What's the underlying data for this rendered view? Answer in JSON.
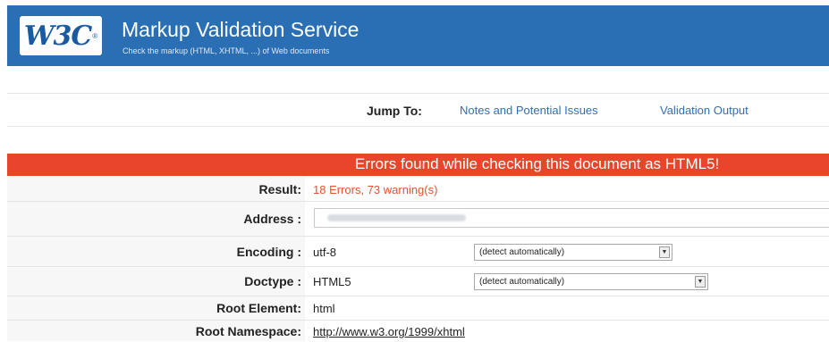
{
  "header": {
    "logo_text": "W3C",
    "logo_reg": "®",
    "title": "Markup Validation Service",
    "subtitle": "Check the markup (HTML, XHTML, ...) of Web documents"
  },
  "jump": {
    "label": "Jump To:",
    "links": [
      "Notes and Potential Issues",
      "Validation Output"
    ]
  },
  "banner": {
    "text": "Errors found while checking this document as HTML5!"
  },
  "results": {
    "result_label": "Result:",
    "result_value": "18 Errors, 73 warning(s)",
    "address_label": "Address :",
    "encoding_label": "Encoding :",
    "encoding_value": "utf-8",
    "encoding_select": "(detect automatically)",
    "doctype_label": "Doctype :",
    "doctype_value": "HTML5",
    "doctype_select": "(detect automatically)",
    "root_element_label": "Root Element:",
    "root_element_value": "html",
    "root_namespace_label": "Root Namespace:",
    "root_namespace_value": "http://www.w3.org/1999/xhtml"
  },
  "colors": {
    "header_bg": "#2a6fb4",
    "error_banner": "#e8452a",
    "error_text": "#e2532f",
    "link": "#2f6fb3"
  },
  "icons": {
    "select_arrow": "chevron-down-icon"
  }
}
